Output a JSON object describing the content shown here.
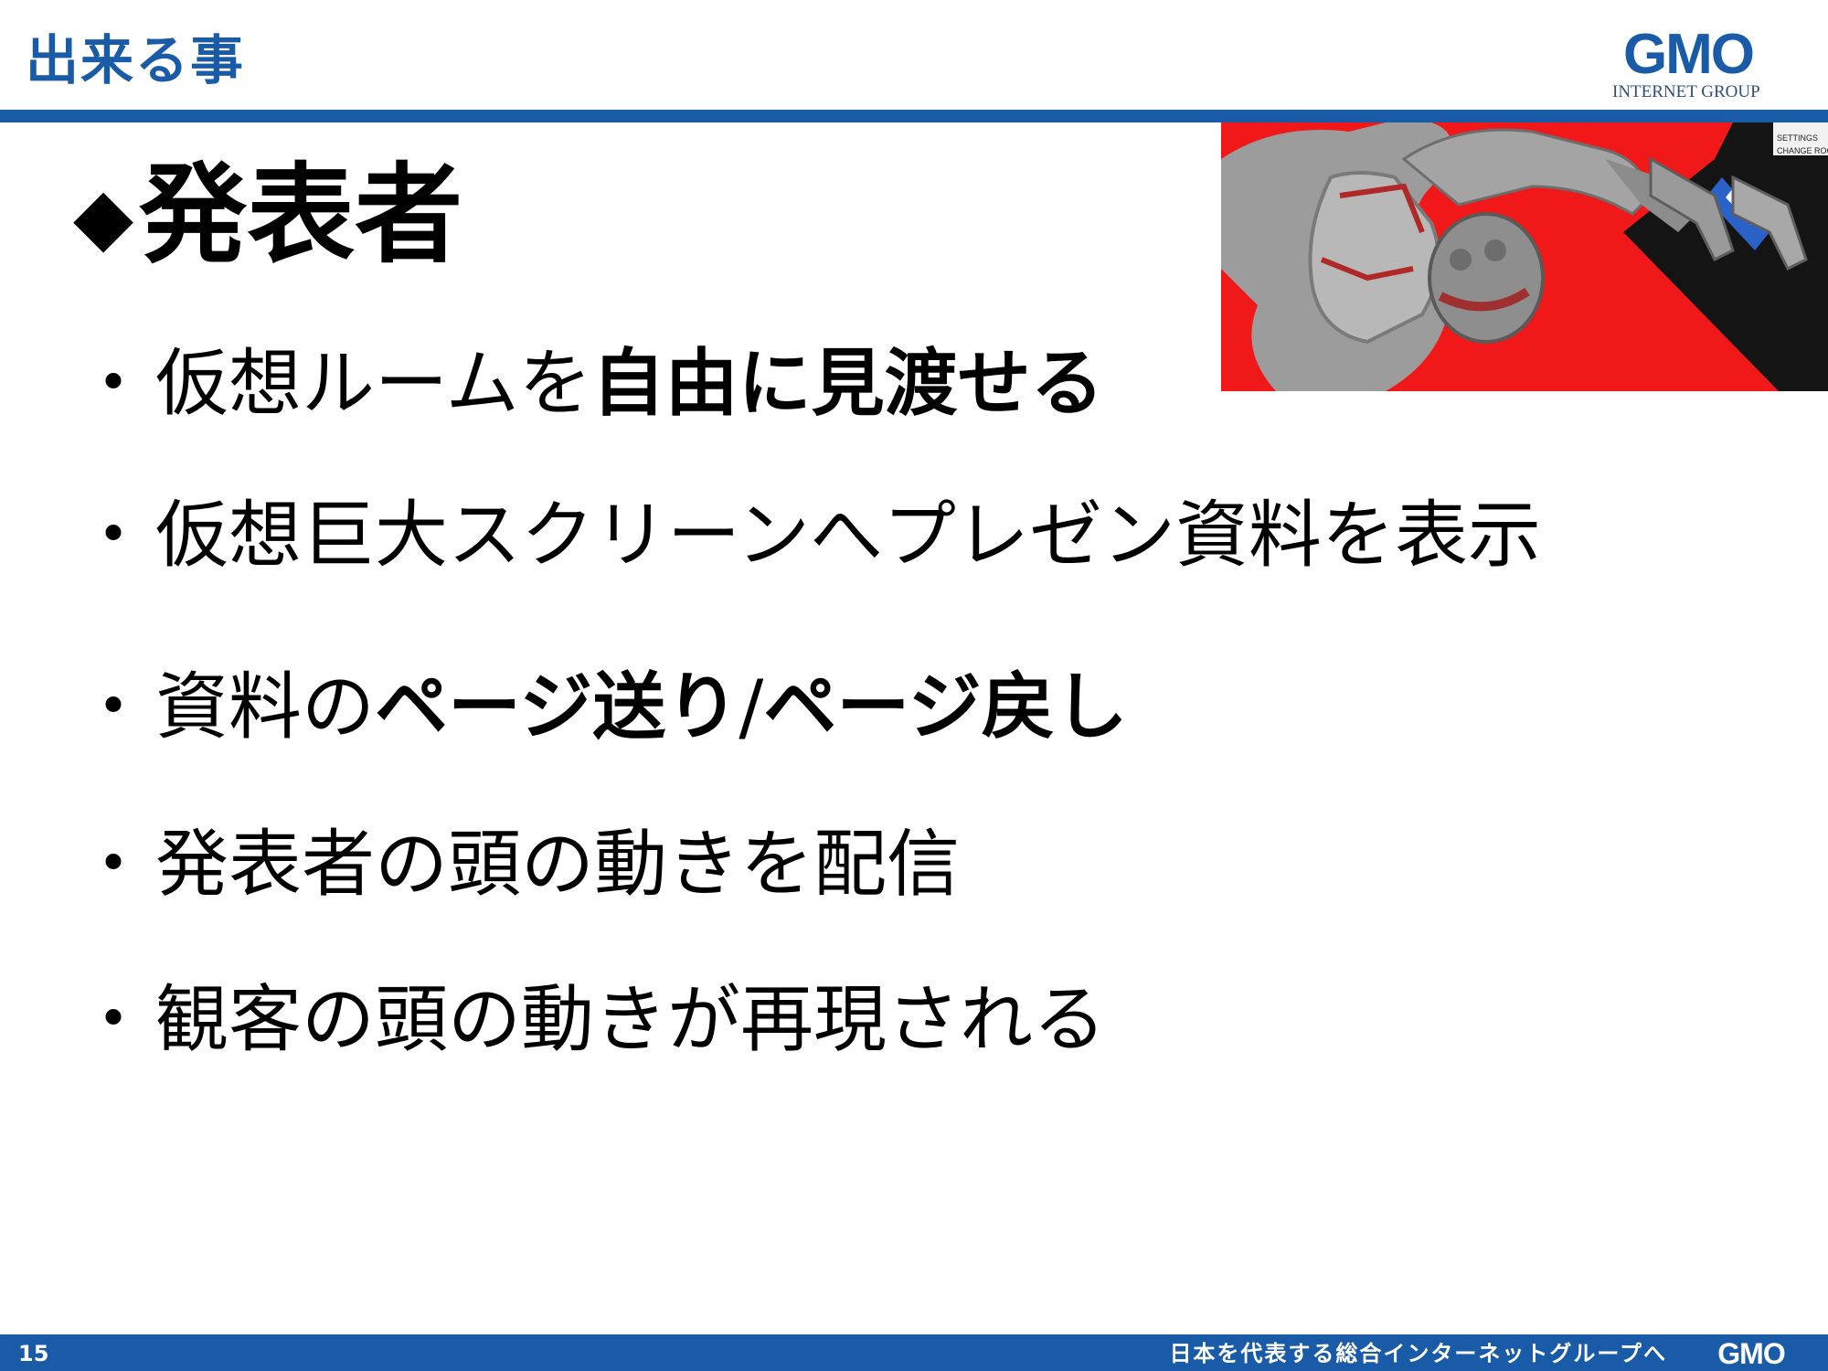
{
  "header": {
    "title": "出来る事",
    "logo_text": "GMO",
    "logo_subtext": "INTERNET GROUP"
  },
  "screenshot": {
    "settings_label": "SETTINGS",
    "change_room_label": "CHANGE ROOM"
  },
  "section": {
    "diamond": "◆",
    "heading": "発表者"
  },
  "bullets": [
    {
      "marker": "・",
      "plain": "仮想ルームを",
      "bold": "自由に見渡せる"
    },
    {
      "marker": "・",
      "plain": "仮想巨大スクリーンへプレゼン資料を表示"
    },
    {
      "marker": "・",
      "plain": "資料の",
      "bold": "ページ送り",
      "slash": "/",
      "bold2": "ページ戻し"
    },
    {
      "marker": "・",
      "plain": "発表者の頭の動きを配信"
    },
    {
      "marker": "・",
      "plain": "観客の頭の動きが再現される"
    }
  ],
  "footer": {
    "page_number": "15",
    "slogan": "日本を代表する総合インターネットグループへ",
    "logo_text": "GMO"
  },
  "colors": {
    "brand_blue": "#1a5ba8",
    "screenshot_red": "#f01818"
  }
}
